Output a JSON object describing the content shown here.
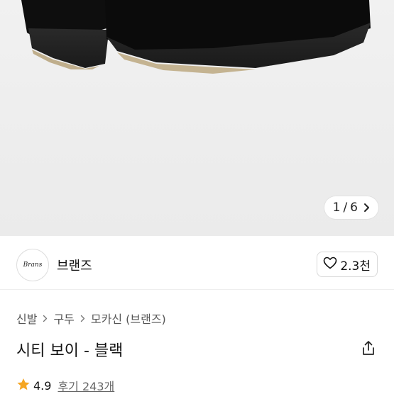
{
  "gallery": {
    "current": "1",
    "separator": "/",
    "total": "6"
  },
  "brand": {
    "logo_text": "Brans",
    "name": "브랜즈",
    "like_count": "2.3천"
  },
  "breadcrumb": [
    "신발",
    "구두",
    "모카신 (브랜즈)"
  ],
  "product": {
    "title": "시티 보이 - 블랙"
  },
  "rating": {
    "score": "4.9",
    "reviews_label": "후기 243개",
    "star_color": "#f5a623"
  },
  "icons": [
    "heart-icon",
    "chevron-right-icon",
    "share-icon",
    "star-icon"
  ]
}
